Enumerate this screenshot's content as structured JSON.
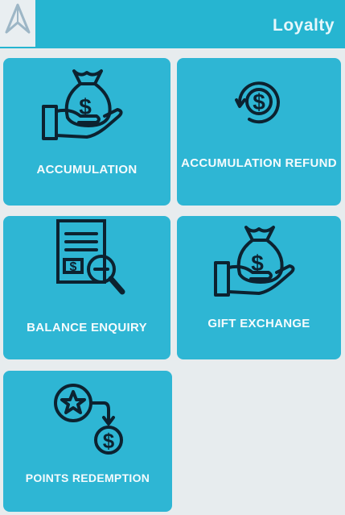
{
  "header": {
    "title": "Loyalty",
    "logo_icon": "app-logo-icon"
  },
  "colors": {
    "tile": "#2eb6d4",
    "header": "#26b5d1",
    "background": "#e7ecee",
    "icon": "#0c2230",
    "label": "#f5fbfd"
  },
  "tiles": [
    {
      "label": "ACCUMULATION",
      "icon": "money-bag-hand-icon"
    },
    {
      "label": "ACCUMULATION REFUND",
      "icon": "dollar-refund-icon"
    },
    {
      "label": "BALANCE ENQUIRY",
      "icon": "document-search-icon"
    },
    {
      "label": "GIFT EXCHANGE",
      "icon": "money-bag-hand-icon"
    },
    {
      "label": "POINTS REDEMPTION",
      "icon": "star-to-dollar-icon"
    }
  ]
}
